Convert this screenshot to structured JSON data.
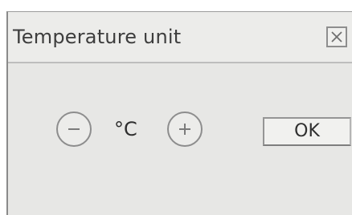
{
  "dialog": {
    "title": "Temperature unit",
    "close_icon": "close-icon",
    "unit_value": "°C",
    "decrease_icon": "minus-icon",
    "increase_icon": "plus-icon",
    "ok_label": "OK"
  },
  "colors": {
    "dialog_background": "#e7e7e5",
    "titlebar_background": "#ececea",
    "text": "#3d3d3d",
    "border": "#8e8e8e"
  }
}
